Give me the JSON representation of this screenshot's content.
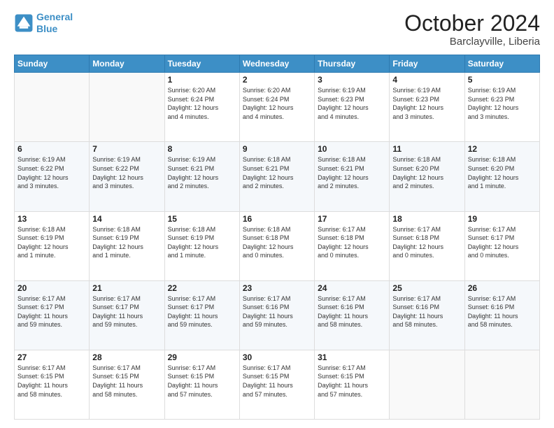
{
  "header": {
    "logo_line1": "General",
    "logo_line2": "Blue",
    "month": "October 2024",
    "location": "Barclayville, Liberia"
  },
  "days_of_week": [
    "Sunday",
    "Monday",
    "Tuesday",
    "Wednesday",
    "Thursday",
    "Friday",
    "Saturday"
  ],
  "weeks": [
    [
      {
        "day": "",
        "info": ""
      },
      {
        "day": "",
        "info": ""
      },
      {
        "day": "1",
        "info": "Sunrise: 6:20 AM\nSunset: 6:24 PM\nDaylight: 12 hours\nand 4 minutes."
      },
      {
        "day": "2",
        "info": "Sunrise: 6:20 AM\nSunset: 6:24 PM\nDaylight: 12 hours\nand 4 minutes."
      },
      {
        "day": "3",
        "info": "Sunrise: 6:19 AM\nSunset: 6:23 PM\nDaylight: 12 hours\nand 4 minutes."
      },
      {
        "day": "4",
        "info": "Sunrise: 6:19 AM\nSunset: 6:23 PM\nDaylight: 12 hours\nand 3 minutes."
      },
      {
        "day": "5",
        "info": "Sunrise: 6:19 AM\nSunset: 6:23 PM\nDaylight: 12 hours\nand 3 minutes."
      }
    ],
    [
      {
        "day": "6",
        "info": "Sunrise: 6:19 AM\nSunset: 6:22 PM\nDaylight: 12 hours\nand 3 minutes."
      },
      {
        "day": "7",
        "info": "Sunrise: 6:19 AM\nSunset: 6:22 PM\nDaylight: 12 hours\nand 3 minutes."
      },
      {
        "day": "8",
        "info": "Sunrise: 6:19 AM\nSunset: 6:21 PM\nDaylight: 12 hours\nand 2 minutes."
      },
      {
        "day": "9",
        "info": "Sunrise: 6:18 AM\nSunset: 6:21 PM\nDaylight: 12 hours\nand 2 minutes."
      },
      {
        "day": "10",
        "info": "Sunrise: 6:18 AM\nSunset: 6:21 PM\nDaylight: 12 hours\nand 2 minutes."
      },
      {
        "day": "11",
        "info": "Sunrise: 6:18 AM\nSunset: 6:20 PM\nDaylight: 12 hours\nand 2 minutes."
      },
      {
        "day": "12",
        "info": "Sunrise: 6:18 AM\nSunset: 6:20 PM\nDaylight: 12 hours\nand 1 minute."
      }
    ],
    [
      {
        "day": "13",
        "info": "Sunrise: 6:18 AM\nSunset: 6:19 PM\nDaylight: 12 hours\nand 1 minute."
      },
      {
        "day": "14",
        "info": "Sunrise: 6:18 AM\nSunset: 6:19 PM\nDaylight: 12 hours\nand 1 minute."
      },
      {
        "day": "15",
        "info": "Sunrise: 6:18 AM\nSunset: 6:19 PM\nDaylight: 12 hours\nand 1 minute."
      },
      {
        "day": "16",
        "info": "Sunrise: 6:18 AM\nSunset: 6:18 PM\nDaylight: 12 hours\nand 0 minutes."
      },
      {
        "day": "17",
        "info": "Sunrise: 6:17 AM\nSunset: 6:18 PM\nDaylight: 12 hours\nand 0 minutes."
      },
      {
        "day": "18",
        "info": "Sunrise: 6:17 AM\nSunset: 6:18 PM\nDaylight: 12 hours\nand 0 minutes."
      },
      {
        "day": "19",
        "info": "Sunrise: 6:17 AM\nSunset: 6:17 PM\nDaylight: 12 hours\nand 0 minutes."
      }
    ],
    [
      {
        "day": "20",
        "info": "Sunrise: 6:17 AM\nSunset: 6:17 PM\nDaylight: 11 hours\nand 59 minutes."
      },
      {
        "day": "21",
        "info": "Sunrise: 6:17 AM\nSunset: 6:17 PM\nDaylight: 11 hours\nand 59 minutes."
      },
      {
        "day": "22",
        "info": "Sunrise: 6:17 AM\nSunset: 6:17 PM\nDaylight: 11 hours\nand 59 minutes."
      },
      {
        "day": "23",
        "info": "Sunrise: 6:17 AM\nSunset: 6:16 PM\nDaylight: 11 hours\nand 59 minutes."
      },
      {
        "day": "24",
        "info": "Sunrise: 6:17 AM\nSunset: 6:16 PM\nDaylight: 11 hours\nand 58 minutes."
      },
      {
        "day": "25",
        "info": "Sunrise: 6:17 AM\nSunset: 6:16 PM\nDaylight: 11 hours\nand 58 minutes."
      },
      {
        "day": "26",
        "info": "Sunrise: 6:17 AM\nSunset: 6:16 PM\nDaylight: 11 hours\nand 58 minutes."
      }
    ],
    [
      {
        "day": "27",
        "info": "Sunrise: 6:17 AM\nSunset: 6:15 PM\nDaylight: 11 hours\nand 58 minutes."
      },
      {
        "day": "28",
        "info": "Sunrise: 6:17 AM\nSunset: 6:15 PM\nDaylight: 11 hours\nand 58 minutes."
      },
      {
        "day": "29",
        "info": "Sunrise: 6:17 AM\nSunset: 6:15 PM\nDaylight: 11 hours\nand 57 minutes."
      },
      {
        "day": "30",
        "info": "Sunrise: 6:17 AM\nSunset: 6:15 PM\nDaylight: 11 hours\nand 57 minutes."
      },
      {
        "day": "31",
        "info": "Sunrise: 6:17 AM\nSunset: 6:15 PM\nDaylight: 11 hours\nand 57 minutes."
      },
      {
        "day": "",
        "info": ""
      },
      {
        "day": "",
        "info": ""
      }
    ]
  ]
}
